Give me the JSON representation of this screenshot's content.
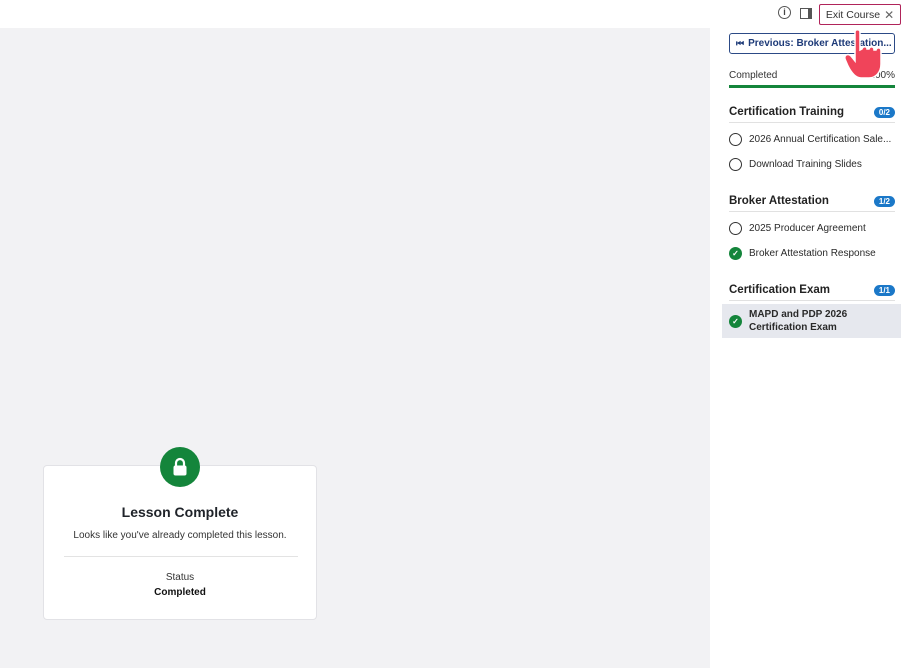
{
  "topbar": {
    "info_icon": "info-icon",
    "panel_icon": "sidebar-toggle-icon",
    "exit_label": "Exit Course",
    "exit_icon": "close-icon"
  },
  "sidebar": {
    "prev_label": "Previous: Broker Attestation...",
    "progress_label": "Completed",
    "progress_value": "100%",
    "progress_fraction": 1.0,
    "sections": [
      {
        "title": "Certification Training",
        "badge": "0/2",
        "lessons": [
          {
            "label": "2026 Annual Certification Sale...",
            "status": "incomplete"
          },
          {
            "label": "Download Training Slides",
            "status": "incomplete"
          }
        ]
      },
      {
        "title": "Broker Attestation",
        "badge": "1/2",
        "lessons": [
          {
            "label": "2025 Producer Agreement",
            "status": "incomplete"
          },
          {
            "label": "Broker Attestation Response",
            "status": "complete"
          }
        ]
      },
      {
        "title": "Certification Exam",
        "badge": "1/1",
        "lessons": [
          {
            "label": "MAPD and PDP 2026 Certification Exam",
            "status": "complete",
            "active": true
          }
        ]
      }
    ]
  },
  "card": {
    "icon": "lock-icon",
    "title": "Lesson Complete",
    "subtitle": "Looks like you've already completed this lesson.",
    "status_label": "Status",
    "status_value": "Completed"
  },
  "colors": {
    "accent_green": "#14853b",
    "badge_blue": "#1b78c8",
    "exit_border": "#b0245a",
    "main_bg": "#f2f2f4"
  }
}
